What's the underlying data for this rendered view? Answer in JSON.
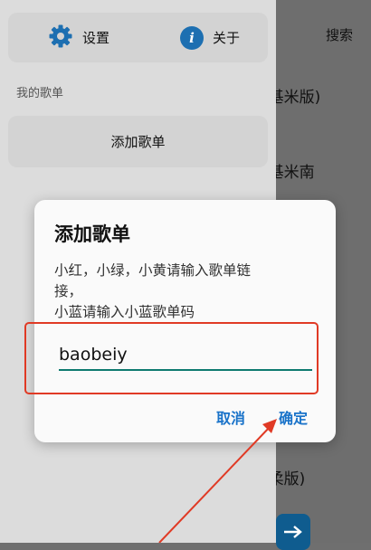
{
  "drawer": {
    "settings_label": "设置",
    "about_label": "关于",
    "about_icon_glyph": "i",
    "section_label": "我的歌单",
    "add_playlist_label": "添加歌单"
  },
  "main": {
    "search_label": "搜索",
    "items": [
      "(基米版)",
      "(基米南",
      "(柔版)"
    ]
  },
  "dialog": {
    "title": "添加歌单",
    "message_lines": [
      "小红，小绿，小黄请输入歌单链",
      "接，",
      "小蓝请输入小蓝歌单码"
    ],
    "input_value": "baobeiy",
    "cancel_label": "取消",
    "ok_label": "确定"
  },
  "colors": {
    "accent": "#1a73c9",
    "input_underline": "#0e7a6f",
    "annotation_red": "#e03a25",
    "icon_blue": "#1d6fb1"
  },
  "icons": {
    "settings": "gear-icon",
    "about": "info-icon",
    "fab": "arrow-right-icon"
  }
}
